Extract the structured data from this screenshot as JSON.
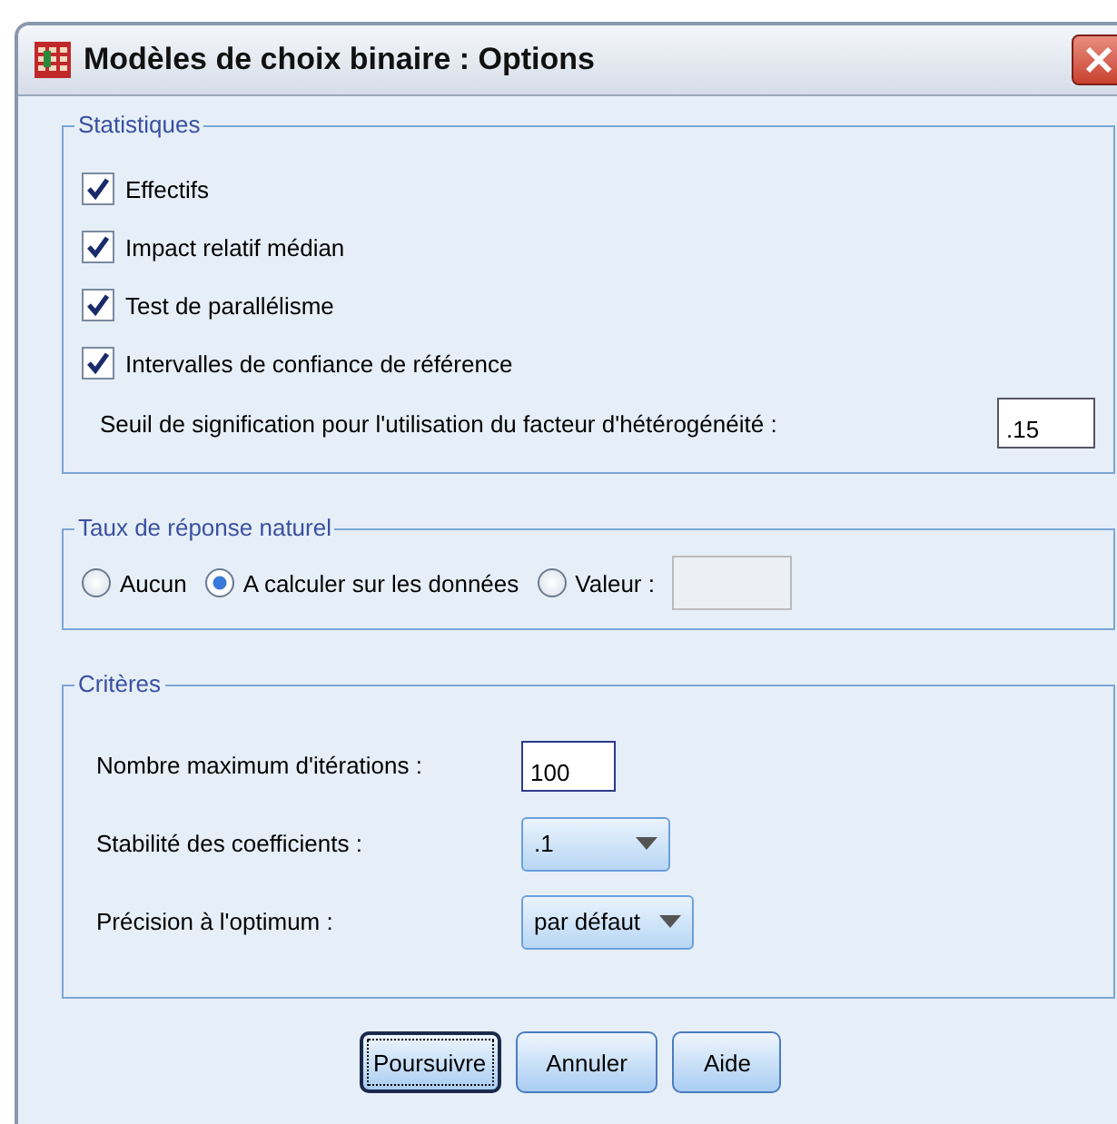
{
  "window": {
    "title": "Modèles de choix binaire : Options"
  },
  "statistics": {
    "title": "Statistiques",
    "checkboxes": [
      {
        "label": "Effectifs",
        "checked": true
      },
      {
        "label": "Impact relatif médian",
        "checked": true
      },
      {
        "label": "Test de parallélisme",
        "checked": true
      },
      {
        "label": "Intervalles de confiance de référence",
        "checked": true
      }
    ],
    "threshold": {
      "label": "Seuil de signification pour l'utilisation du facteur d'hétérogénéité :",
      "value": ".15"
    }
  },
  "natural_response": {
    "title": "Taux de réponse naturel",
    "radios": [
      {
        "label": "Aucun",
        "selected": false
      },
      {
        "label": "A calculer sur les données",
        "selected": true
      },
      {
        "label": "Valeur :",
        "selected": false
      }
    ],
    "value_field": {
      "disabled": true
    }
  },
  "criteria": {
    "title": "Critères",
    "rows": [
      {
        "kind": "input",
        "label": "Nombre maximum d'itérations :",
        "value": "100"
      },
      {
        "kind": "dropdown",
        "label": "Stabilité des coefficients :",
        "value": ".1"
      },
      {
        "kind": "dropdown",
        "label": "Précision à l'optimum :",
        "value": "par défaut"
      }
    ]
  },
  "buttons": [
    {
      "label": "Poursuivre",
      "focused": true
    },
    {
      "label": "Annuler",
      "focused": false
    },
    {
      "label": "Aide",
      "focused": false
    }
  ]
}
